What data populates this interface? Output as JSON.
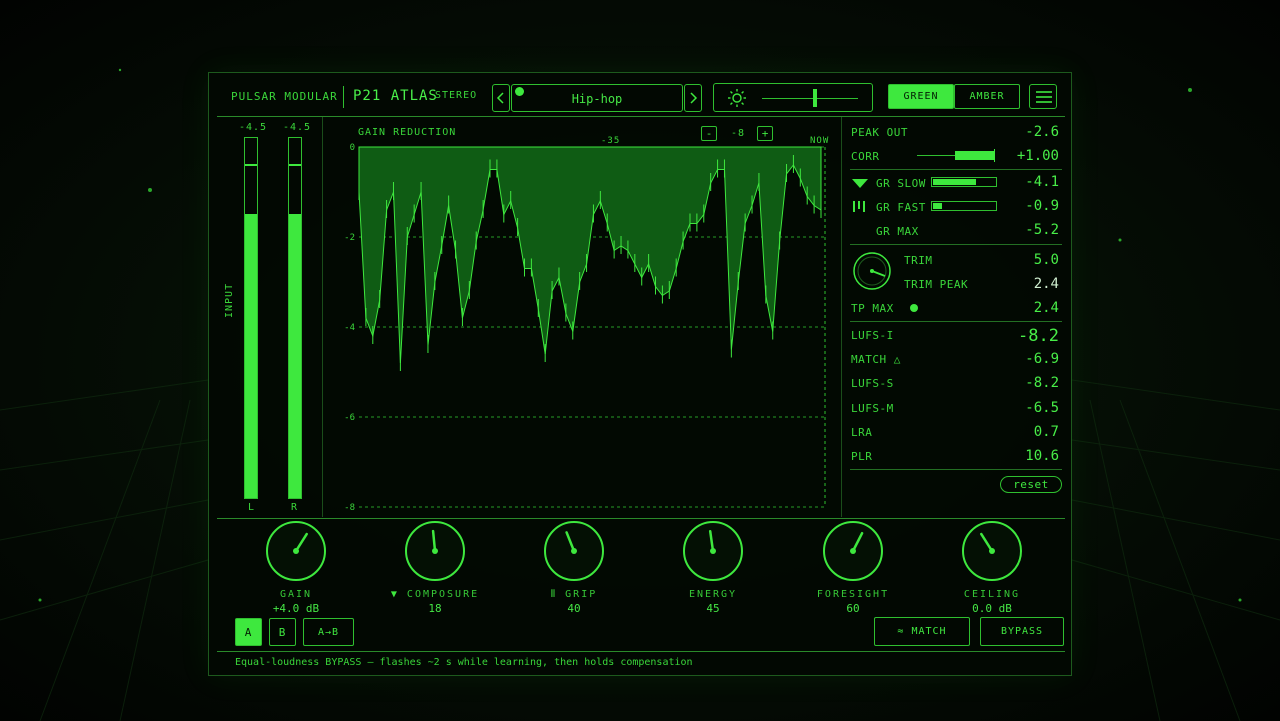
{
  "header": {
    "brand": "PULSAR MODULAR",
    "product": "P21 ATLAS",
    "mode": "STEREO",
    "preset": "Hip-hop",
    "prev_icon": "chevron-left-icon",
    "next_icon": "chevron-right-icon",
    "brightness_icon": "sun-icon",
    "brightness_level": 0.55,
    "theme_green": "GREEN",
    "theme_amber": "AMBER",
    "theme_selected": "GREEN",
    "menu_icon": "hamburger-icon"
  },
  "input_meter": {
    "label": "INPUT",
    "left_peak": "-4.5",
    "right_peak": "-4.5",
    "left_label": "L",
    "right_label": "R",
    "left_level": 0.79,
    "right_level": 0.79
  },
  "gr_graph": {
    "title": "GAIN REDUCTION",
    "zoom_minus": "-",
    "zoom_value": "-8",
    "zoom_plus": "+",
    "time_marker": "-35",
    "now_label": "NOW",
    "y_ticks": [
      "0",
      "-2",
      "-4",
      "-6",
      "-8"
    ]
  },
  "chart_data": {
    "type": "area",
    "title": "GAIN REDUCTION",
    "xlabel": "",
    "ylabel": "",
    "ylim": [
      -8,
      0
    ],
    "grid": true,
    "y_ticks": [
      0,
      -2,
      -4,
      -6,
      -8
    ],
    "series": [
      {
        "values": [
          -1.0,
          -3.8,
          -4.2,
          -3.4,
          -1.4,
          -1.0,
          -4.8,
          -2.0,
          -1.5,
          -1.0,
          -4.4,
          -3.0,
          -2.2,
          -1.3,
          -2.3,
          -3.8,
          -3.2,
          -2.1,
          -1.4,
          -0.5,
          -0.5,
          -1.5,
          -1.2,
          -1.8,
          -2.7,
          -2.7,
          -3.6,
          -4.6,
          -3.2,
          -2.9,
          -3.7,
          -4.1,
          -3.0,
          -2.6,
          -1.5,
          -1.2,
          -1.7,
          -2.3,
          -2.2,
          -2.3,
          -2.6,
          -2.9,
          -2.6,
          -3.1,
          -3.3,
          -3.2,
          -2.7,
          -2.1,
          -1.7,
          -1.7,
          -1.5,
          -0.8,
          -0.5,
          -0.5,
          -4.5,
          -3.0,
          -1.7,
          -1.3,
          -0.8,
          -3.3,
          -4.1,
          -2.1,
          -0.6,
          -0.4,
          -0.7,
          -1.1,
          -1.3,
          -1.4
        ]
      }
    ]
  },
  "readouts": {
    "peak_out": {
      "label": "PEAK OUT",
      "value": "-2.6"
    },
    "corr": {
      "label": "CORR",
      "value": "+1.00",
      "level": 1.0
    },
    "gr_slow": {
      "label": "GR SLOW",
      "value": "-4.1",
      "icon": "composure-triangle-icon",
      "level": 0.7
    },
    "gr_fast": {
      "label": "GR FAST",
      "value": "-0.9",
      "icon": "grip-bars-icon",
      "level": 0.15
    },
    "gr_max": {
      "label": "GR MAX",
      "value": "-5.2"
    },
    "trim": {
      "label": "TRIM",
      "value": "5.0"
    },
    "trim_peak": {
      "label": "TRIM PEAK",
      "value": "2.4"
    },
    "tp_max": {
      "label": "TP MAX",
      "value": "2.4"
    },
    "lufs_i": {
      "label": "LUFS-I",
      "value": "-8.2"
    },
    "match": {
      "label": "MATCH △",
      "value": "-6.9"
    },
    "lufs_s": {
      "label": "LUFS-S",
      "value": "-8.2"
    },
    "lufs_m": {
      "label": "LUFS-M",
      "value": "-6.5"
    },
    "lra": {
      "label": "LRA",
      "value": "0.7"
    },
    "plr": {
      "label": "PLR",
      "value": "10.6"
    },
    "reset": "reset"
  },
  "knobs": [
    {
      "label": "GAIN",
      "value": "+4.0 dB",
      "pos": 0.62
    },
    {
      "label": "COMPOSURE",
      "value": "18",
      "pos": 0.48,
      "icon": "composure-triangle-icon"
    },
    {
      "label": "GRIP",
      "value": "40",
      "pos": 0.42,
      "icon": "grip-bars-icon"
    },
    {
      "label": "ENERGY",
      "value": "45",
      "pos": 0.47
    },
    {
      "label": "FORESIGHT",
      "value": "60",
      "pos": 0.6
    },
    {
      "label": "CEILING",
      "value": "0.0 dB",
      "pos": 0.38
    }
  ],
  "footer": {
    "a": "A",
    "b": "B",
    "ab": "A→B",
    "match": "≈ MATCH",
    "bypass": "BYPASS",
    "status": "Equal-loudness BYPASS — flashes ~2 s while learning, then holds compensation"
  },
  "colors": {
    "accent": "#3ee83e",
    "dark_fill": "#0e5a12",
    "background": "#030703"
  }
}
